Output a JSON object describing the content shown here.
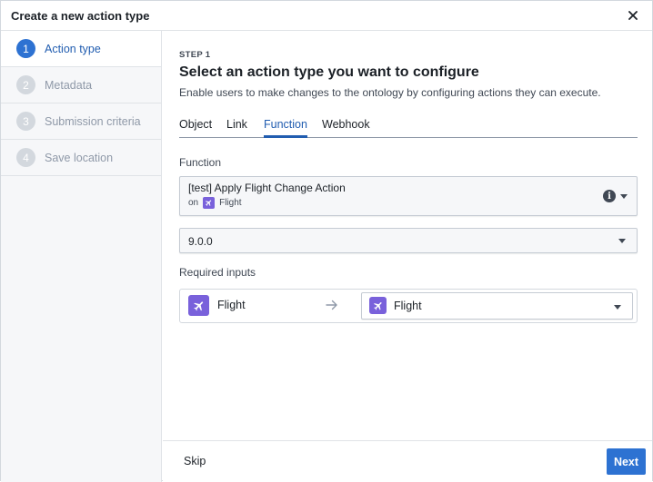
{
  "dialog": {
    "title": "Create a new action type",
    "close_icon": "close-icon"
  },
  "sidebar": {
    "steps": [
      {
        "number": "1",
        "label": "Action type",
        "active": true
      },
      {
        "number": "2",
        "label": "Metadata",
        "active": false
      },
      {
        "number": "3",
        "label": "Submission criteria",
        "active": false
      },
      {
        "number": "4",
        "label": "Save location",
        "active": false
      }
    ]
  },
  "main": {
    "step_kicker": "STEP 1",
    "title": "Select an action type you want to configure",
    "description": "Enable users to make changes to the ontology by configuring actions they can execute.",
    "tabs": [
      {
        "label": "Object",
        "active": false
      },
      {
        "label": "Link",
        "active": false
      },
      {
        "label": "Function",
        "active": true
      },
      {
        "label": "Webhook",
        "active": false
      }
    ],
    "function_label": "Function",
    "function_select": {
      "name": "[test] Apply Flight Change Action",
      "on_word": "on",
      "object_type": "Flight",
      "object_icon": "airplane-icon"
    },
    "version_select": {
      "value": "9.0.0"
    },
    "required_inputs_label": "Required inputs",
    "required_inputs": {
      "source_label": "Flight",
      "target_label": "Flight",
      "arrow_icon": "arrow-right-icon"
    }
  },
  "footer": {
    "skip_label": "Skip",
    "next_label": "Next"
  },
  "colors": {
    "accent": "#2d72d2",
    "object_purple": "#7961db",
    "sidebar_bg": "#f6f7f9"
  }
}
